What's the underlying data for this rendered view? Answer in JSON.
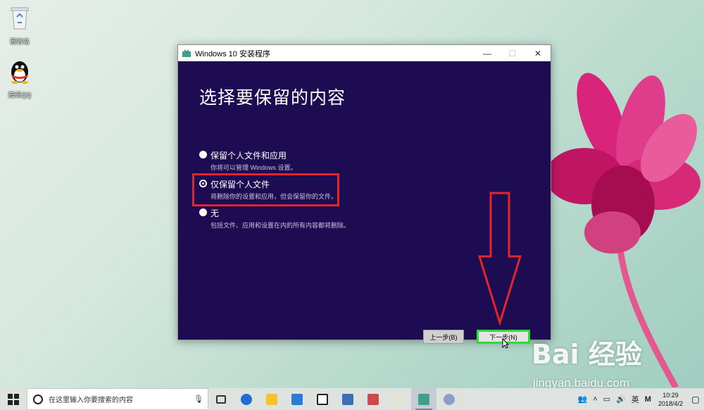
{
  "desktop": {
    "icons": [
      {
        "label": "回收站",
        "icon": "recycle-bin-icon"
      },
      {
        "label": "腾讯QQ",
        "icon": "qq-penguin-icon"
      }
    ]
  },
  "window": {
    "title": "Windows 10 安装程序",
    "controls": {
      "minimize": "—",
      "maximize": "☐",
      "close": "✕"
    },
    "heading": "选择要保留的内容",
    "options": [
      {
        "label": "保留个人文件和应用",
        "description": "你将可以管理 Windows 设置。",
        "selected": false
      },
      {
        "label": "仅保留个人文件",
        "description": "将删除你的设置和应用，但会保留你的文件。",
        "selected": true
      },
      {
        "label": "无",
        "description": "包括文件、应用和设置在内的所有内容都将删除。",
        "selected": false
      }
    ],
    "buttons": {
      "back": "上一步(B)",
      "next": "下一步(N)"
    },
    "colors": {
      "background": "#1e0c52",
      "annotation_red": "#e1262a",
      "annotation_green": "#2ddc36"
    }
  },
  "watermark": {
    "logo": "Bai 经验",
    "url": "jingyan.baidu.com"
  },
  "taskbar": {
    "search_placeholder": "在这里输入你要搜索的内容",
    "apps": [
      "task-view-icon",
      "edge-icon",
      "file-explorer-icon",
      "store-icon",
      "mail-icon",
      "photo-icon",
      "media-icon",
      "paint-icon",
      "setup-icon",
      "paint-palette-icon"
    ],
    "tray": {
      "ime": "英",
      "ime2": "M"
    },
    "clock": {
      "time": "10:29",
      "date": "2018/4/2"
    }
  }
}
